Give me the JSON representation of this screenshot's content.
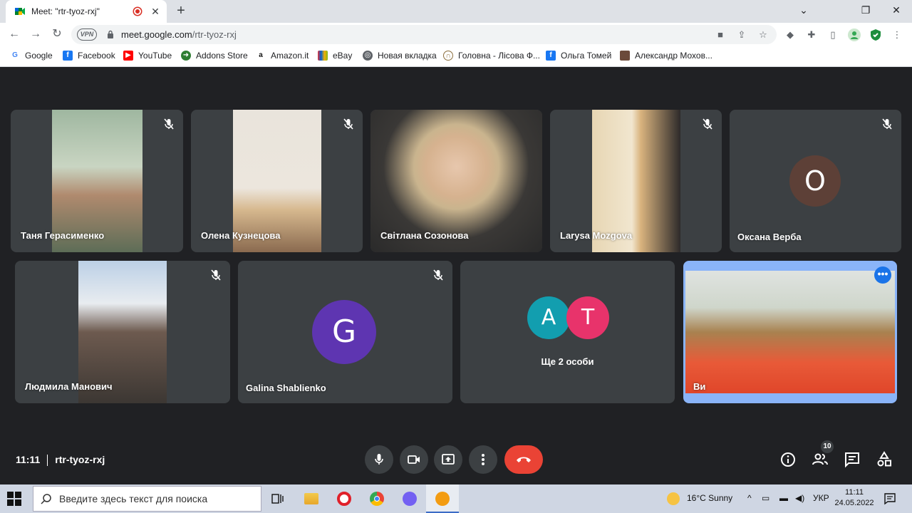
{
  "browser": {
    "tab_title": "Meet: \"rtr-tyoz-rxj\"",
    "url_host": "meet.google.com",
    "url_path": "/rtr-tyoz-rxj",
    "vpn_label": "VPN",
    "bookmarks": [
      {
        "label": "Google",
        "icon": "google-icon",
        "color": "#4285f4"
      },
      {
        "label": "Facebook",
        "icon": "facebook-icon",
        "color": "#1877f2"
      },
      {
        "label": "YouTube",
        "icon": "youtube-icon",
        "color": "#ff0000"
      },
      {
        "label": "Addons Store",
        "icon": "addons-store-icon",
        "color": "#2e7d32"
      },
      {
        "label": "Amazon.it",
        "icon": "amazon-icon",
        "color": "#111111"
      },
      {
        "label": "eBay",
        "icon": "ebay-icon",
        "color": "#e53238"
      },
      {
        "label": "Новая вкладка",
        "icon": "globe-icon",
        "color": "#5f6368"
      },
      {
        "label": "Головна - Лісова Ф...",
        "icon": "site-icon",
        "color": "#8a6d3b"
      },
      {
        "label": "Ольга Томей",
        "icon": "facebook-icon",
        "color": "#1877f2"
      },
      {
        "label": "Александр Мохов...",
        "icon": "profile-icon",
        "color": "#6b4a3a"
      }
    ]
  },
  "meet": {
    "participants": [
      {
        "name": "Таня Герасименко",
        "muted": true
      },
      {
        "name": "Олена Кузнецова",
        "muted": true
      },
      {
        "name": "Світлана Созонова",
        "muted": false
      },
      {
        "name": "Larysa Mozgova",
        "muted": true
      },
      {
        "name": "Оксана Верба",
        "muted": true,
        "avatar_letter": "O",
        "avatar_color": "#5d4037"
      },
      {
        "name": "Людмила Манович",
        "muted": true
      },
      {
        "name": "Galina Shablienko",
        "muted": true,
        "avatar_letter": "G",
        "avatar_color": "#5e35b1"
      },
      {
        "name": "Ще 2 особи",
        "avatars": [
          {
            "letter": "A",
            "color": "#129eaf"
          },
          {
            "letter": "T",
            "color": "#e8336b"
          }
        ]
      },
      {
        "name": "Ви",
        "self": true
      }
    ],
    "time": "11:11",
    "meeting_code": "rtr-tyoz-rxj",
    "people_count": "10",
    "accent_color": "#8ab4f8",
    "end_call_color": "#ea4335"
  },
  "taskbar": {
    "search_placeholder": "Введите здесь текст для поиска",
    "weather": "16°C  Sunny",
    "language": "УКР",
    "clock_time": "11:11",
    "clock_date": "24.05.2022"
  }
}
